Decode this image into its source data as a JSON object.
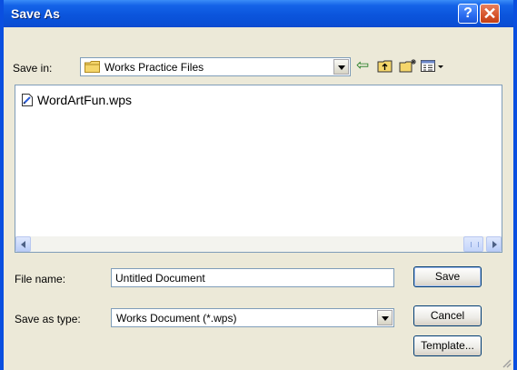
{
  "window": {
    "title": "Save As",
    "help_glyph": "?",
    "close_glyph": "✕"
  },
  "save_in": {
    "label": "Save in:",
    "value": "Works Practice Files",
    "icon": "folder-icon"
  },
  "toolbar": {
    "icons": [
      "back-arrow-icon",
      "up-folder-icon",
      "new-folder-icon",
      "view-menu-icon"
    ],
    "back_glyph": "⇦"
  },
  "files": [
    {
      "name": "WordArtFun.wps",
      "icon": "document-icon"
    }
  ],
  "file_name": {
    "label": "File name:",
    "value": "Untitled Document"
  },
  "save_as_type": {
    "label": "Save as type:",
    "value": "Works Document (*.wps)"
  },
  "buttons": {
    "save": "Save",
    "cancel": "Cancel",
    "template": "Template..."
  },
  "colors": {
    "titlebar": "#0a4fd6",
    "dialog_bg": "#ece9d8",
    "close": "#d6542b",
    "folder": "#f5d66b"
  }
}
